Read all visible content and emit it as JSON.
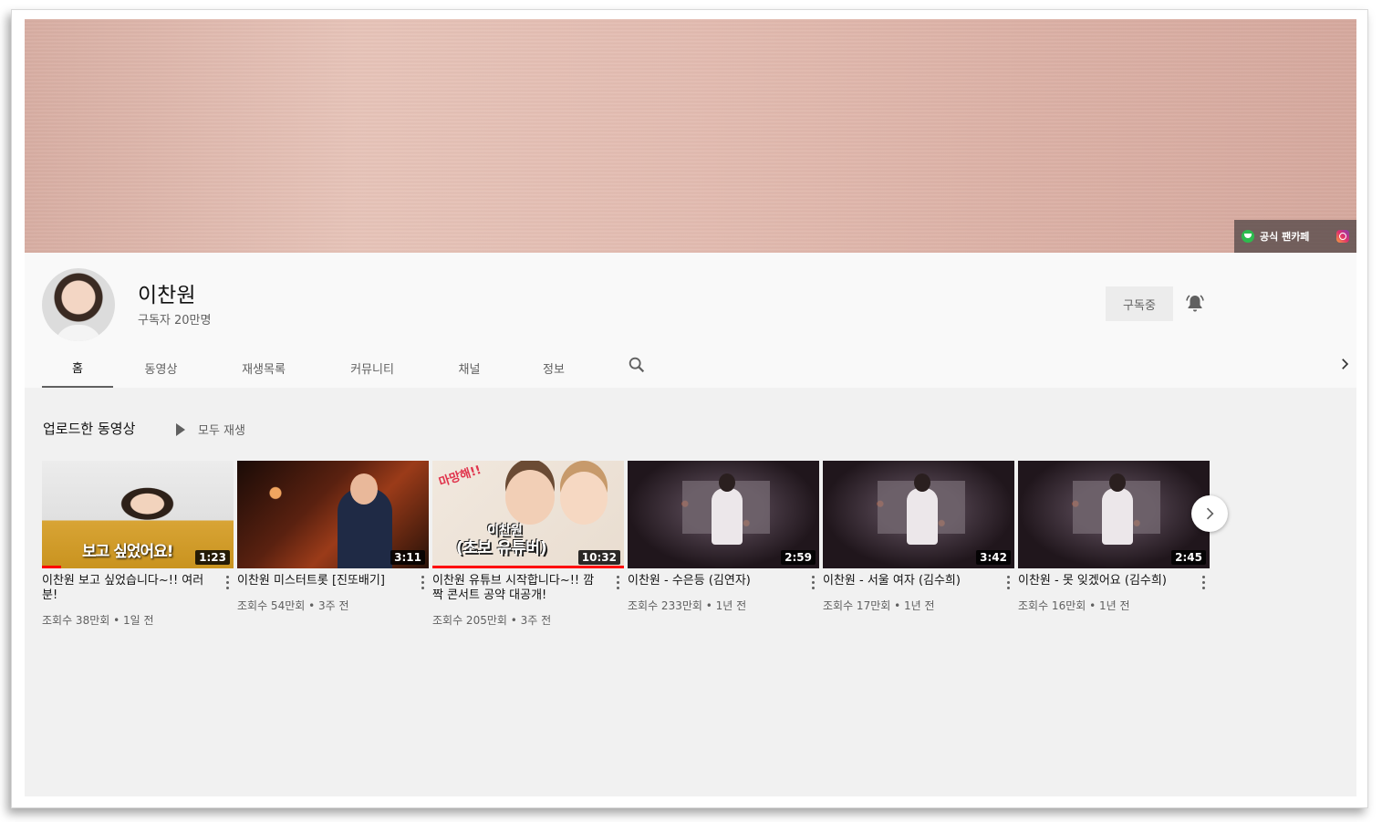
{
  "banner": {
    "cafe_label": "공식 팬카페",
    "cafe_icon": "cafe-icon",
    "instagram_icon": "instagram-icon"
  },
  "channel": {
    "name": "이찬원",
    "subscribers": "구독자 20만명",
    "subscribed_label": "구독중",
    "bell_icon": "bell-icon"
  },
  "tabs": [
    {
      "label": "홈",
      "active": true
    },
    {
      "label": "동영상"
    },
    {
      "label": "재생목록"
    },
    {
      "label": "커뮤니티"
    },
    {
      "label": "채널"
    },
    {
      "label": "정보"
    }
  ],
  "section": {
    "title": "업로드한 동영상",
    "play_all": "모두 재생"
  },
  "videos": [
    {
      "title": "이찬원 보고 싶었습니다~!! 여러분!",
      "duration": "1:23",
      "meta": "조회수 38만회 • 1일 전",
      "thumb_caption": "보고 싶었어요!",
      "watched": 0.1
    },
    {
      "title": "이찬원 미스터트롯 [진또배기]",
      "duration": "3:11",
      "meta": "조회수 54만회 • 3주 전",
      "thumb_caption": "",
      "watched": 0
    },
    {
      "title": "이찬원 유튜브 시작합니다~!! 깜짝 콘서트 공약 대공개!",
      "duration": "10:32",
      "meta": "조회수 205만회 • 3주 전",
      "thumb_caption": "(초보 유튜버)",
      "thumb_caption_top": "이찬원",
      "thumb_stamp": "마망해!!",
      "watched": 1.0
    },
    {
      "title": "이찬원 - 수은등 (김연자)",
      "duration": "2:59",
      "meta": "조회수 233만회 • 1년 전",
      "watched": 0
    },
    {
      "title": "이찬원 - 서울 여자 (김수희)",
      "duration": "3:42",
      "meta": "조회수 17만회 • 1년 전",
      "watched": 0
    },
    {
      "title": "이찬원 - 못 잊겠어요 (김수희)",
      "duration": "2:45",
      "meta": "조회수 16만회 • 1년 전",
      "watched": 0
    }
  ],
  "colors": {
    "progress_red": "#ff0000",
    "text_primary": "#111111",
    "text_secondary": "#606060"
  }
}
